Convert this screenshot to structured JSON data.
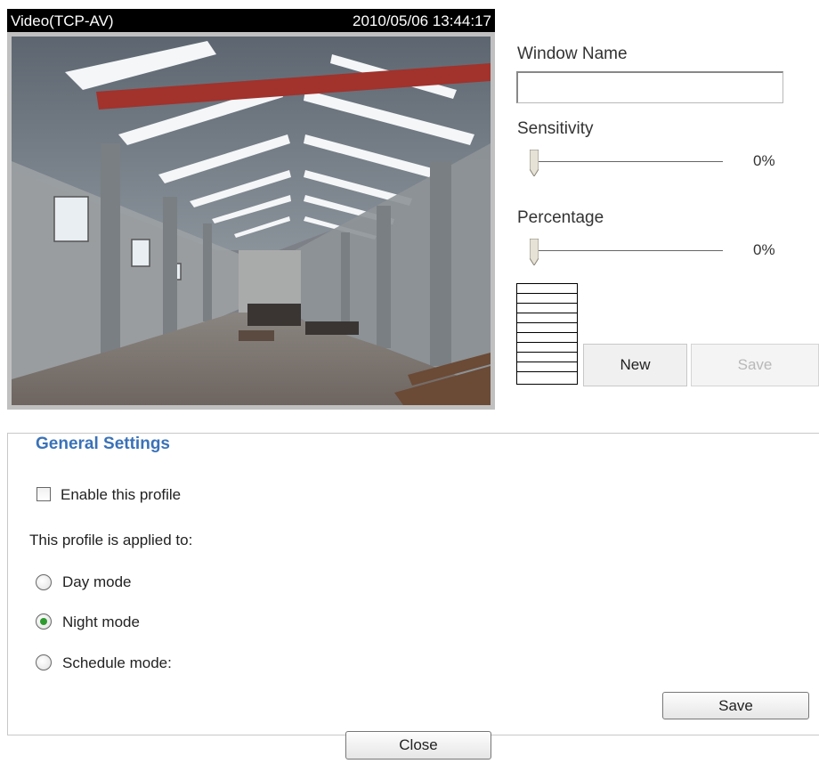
{
  "video": {
    "title": "Video(TCP-AV)",
    "timestamp": "2010/05/06 13:44:17"
  },
  "window_editor": {
    "window_name_label": "Window Name",
    "window_name_value": "",
    "sensitivity_label": "Sensitivity",
    "sensitivity_value": "0%",
    "sensitivity_level": 0,
    "percentage_label": "Percentage",
    "percentage_value": "0%",
    "percentage_level": 0,
    "new_button": "New",
    "save_button": "Save"
  },
  "general_settings": {
    "legend": "General Settings",
    "enable_label": "Enable this profile",
    "enable_checked": false,
    "applied_to_label": "This profile is applied to:",
    "modes": [
      {
        "label": "Day mode",
        "selected": false
      },
      {
        "label": "Night mode",
        "selected": true
      },
      {
        "label": "Schedule mode:",
        "selected": false
      }
    ],
    "save_button": "Save"
  },
  "footer": {
    "close_button": "Close"
  },
  "colors": {
    "legend": "#3a72b8",
    "radio_selected": "#2f9a2f",
    "video_header_bg": "#000000"
  }
}
